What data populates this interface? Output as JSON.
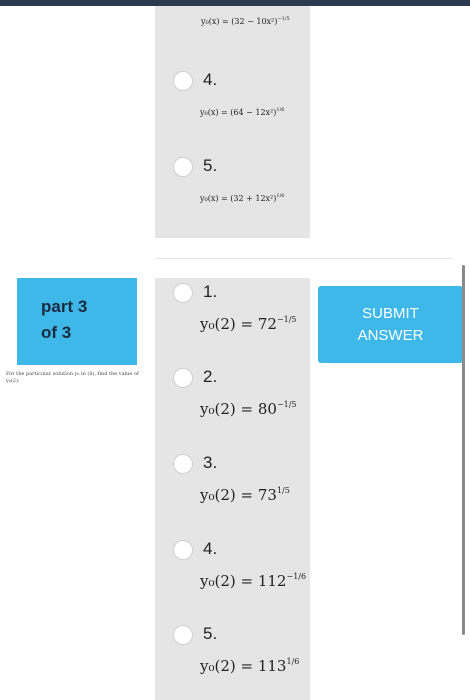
{
  "part": {
    "line1": "part 3",
    "line2": "of 3"
  },
  "question": "For the particular solution y₀ in (ii), find the value of y₀(2).",
  "submit": {
    "line1": "SUBMIT",
    "line2": "ANSWER"
  },
  "previous_part": {
    "top_cutoff_formula": {
      "base": "y₀(x) = (32 − 10x²)",
      "exponent": "−1/5"
    },
    "options": [
      {
        "number": "4.",
        "base": "y₀(x) = (64 − 12x²)",
        "exponent": "1/6"
      },
      {
        "number": "5.",
        "base": "y₀(x) = (32 + 12x²)",
        "exponent": "1/6"
      }
    ]
  },
  "current_part": {
    "options": [
      {
        "number": "1.",
        "base": "y₀(2) = 72",
        "exponent": "−1/5"
      },
      {
        "number": "2.",
        "base": "y₀(2) = 80",
        "exponent": "−1/5"
      },
      {
        "number": "3.",
        "base": "y₀(2) = 73",
        "exponent": "1/5"
      },
      {
        "number": "4.",
        "base": "y₀(2) = 112",
        "exponent": "−1/6"
      },
      {
        "number": "5.",
        "base": "y₀(2) = 113",
        "exponent": "1/6"
      }
    ]
  },
  "colors": {
    "accent": "#3db8e8",
    "panel": "#e5e5e5",
    "topbar": "#2c3a50"
  }
}
